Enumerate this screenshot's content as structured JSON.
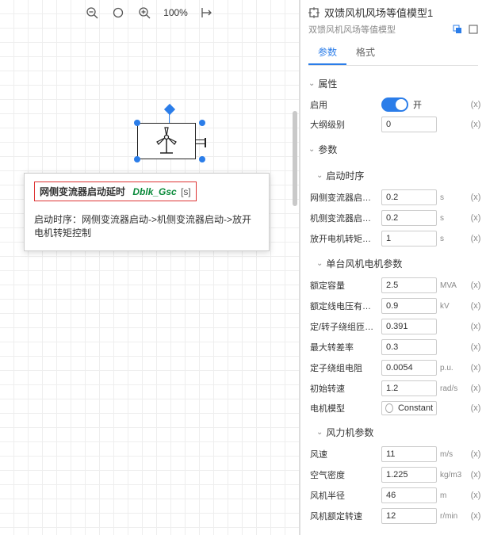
{
  "toolbar": {
    "zoom": "100%"
  },
  "tooltip": {
    "title": "网侧变流器启动延时",
    "variable": "Dblk_Gsc",
    "unit": "[s]",
    "desc": "启动时序：网侧变流器启动->机侧变流器启动->放开电机转矩控制"
  },
  "panel": {
    "title": "双馈风机风场等值模型1",
    "subtitle": "双馈风机风场等值模型",
    "tabs": {
      "params": "参数",
      "format": "格式"
    }
  },
  "sections": {
    "attrs_title": "属性",
    "params_title": "参数",
    "seq_title": "启动时序",
    "single_title": "单台风机电机参数",
    "wind_title": "风力机参数"
  },
  "attrs": {
    "enable_label": "启用",
    "enable_state": "开",
    "outline_label": "大纲级别",
    "outline_value": "0"
  },
  "seq": {
    "gsc_label": "网侧变流器启动...",
    "gsc_value": "0.2",
    "msc_label": "机侧变流器启动...",
    "msc_value": "0.2",
    "torque_label": "放开电机转矩控...",
    "torque_value": "1"
  },
  "single": {
    "capacity_label": "额定容量",
    "capacity_value": "2.5",
    "capacity_unit": "MVA",
    "voltage_label": "额定线电压有效值",
    "voltage_value": "0.9",
    "voltage_unit": "kV",
    "ratio_label": "定/转子绕组匝数...",
    "ratio_value": "0.391",
    "slip_label": "最大转差率",
    "slip_value": "0.3",
    "res_label": "定子绕组电阻",
    "res_value": "0.0054",
    "res_unit": "p.u.",
    "speed_label": "初始转速",
    "speed_value": "1.2",
    "speed_unit": "rad/s",
    "model_label": "电机模型",
    "model_value": "Constant"
  },
  "wind": {
    "speed_label": "风速",
    "speed_value": "11",
    "speed_unit": "m/s",
    "density_label": "空气密度",
    "density_value": "1.225",
    "density_unit": "kg/m3",
    "radius_label": "风机半径",
    "radius_value": "46",
    "radius_unit": "m",
    "rated_label": "风机额定转速",
    "rated_value": "12",
    "rated_unit": "r/min"
  },
  "common": {
    "x": "(x)",
    "unit_s": "s"
  }
}
